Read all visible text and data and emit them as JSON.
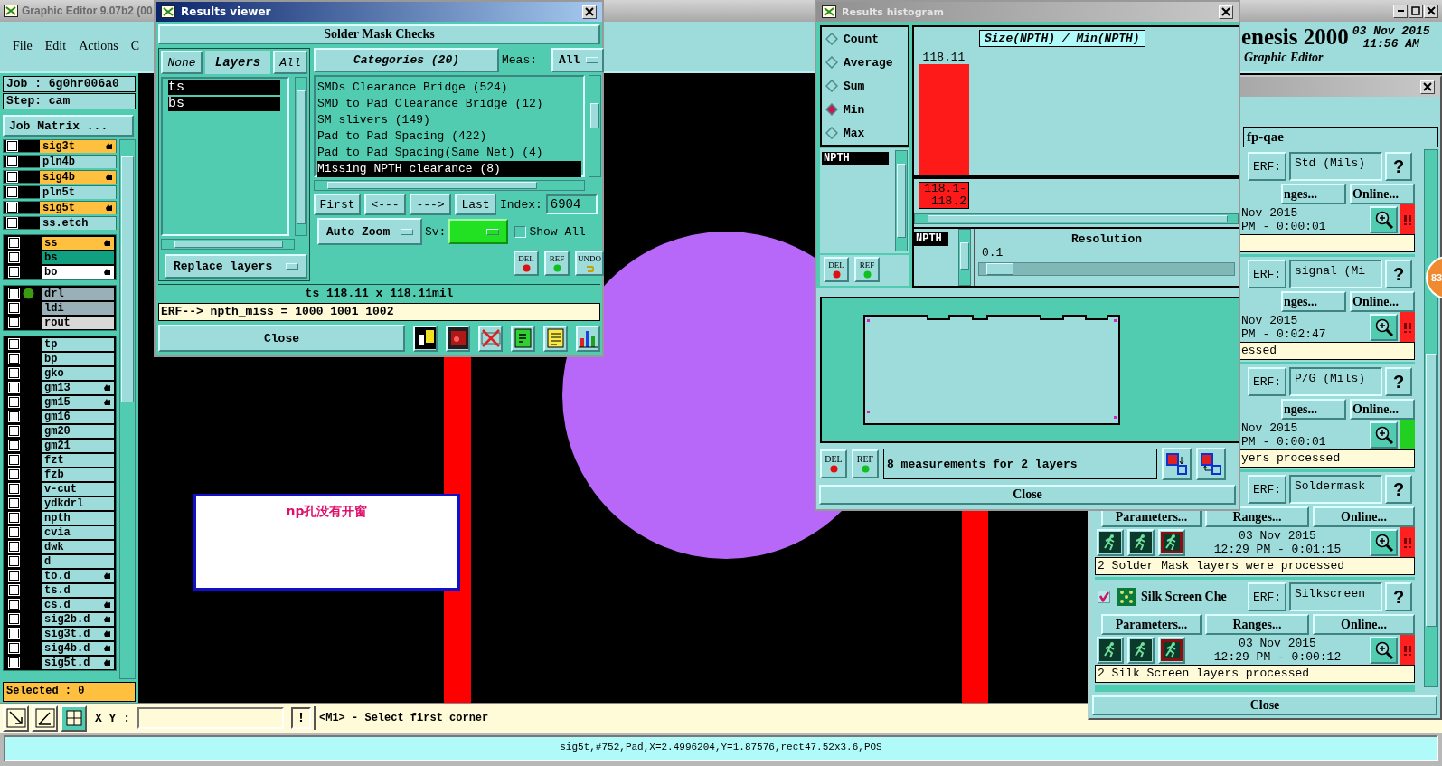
{
  "main_window": {
    "title": "Graphic Editor 9.07b2 (00",
    "menu": [
      "File",
      "Edit",
      "Actions",
      "C"
    ],
    "product": "enesis 2000",
    "date": "03 Nov 2015",
    "time": "11:56 AM",
    "subtitle": "Graphic Editor"
  },
  "job_panel": {
    "job": "Job : 6g0hr006a0",
    "step": "Step: cam",
    "matrix_button": "Job Matrix ...",
    "selected": "Selected : 0",
    "layer_groups": [
      {
        "spaced": true,
        "layers": [
          {
            "name": "sig3t",
            "color": "#ffc040",
            "checked": false,
            "marked": true,
            "active": false
          },
          {
            "name": "pln4b",
            "color": "#9edcdc",
            "checked": false,
            "marked": false,
            "active": false
          },
          {
            "name": "sig4b",
            "color": "#ffc040",
            "checked": false,
            "marked": true,
            "active": false
          },
          {
            "name": "pln5t",
            "color": "#9edcdc",
            "checked": false,
            "marked": false,
            "active": false
          },
          {
            "name": "sig5t",
            "color": "#ffc040",
            "checked": false,
            "marked": true,
            "active": false
          },
          {
            "name": "ss.etch",
            "color": "#9edcdc",
            "checked": false,
            "marked": false,
            "active": false
          }
        ]
      },
      {
        "spaced": false,
        "layers": [
          {
            "name": "ss",
            "color": "#ffc040",
            "checked": false,
            "marked": true,
            "active": false
          },
          {
            "name": "bs",
            "color": "#10a080",
            "checked": false,
            "marked": false,
            "active": false
          },
          {
            "name": "bo",
            "color": "#ffffff",
            "checked": false,
            "marked": true,
            "active": false
          }
        ]
      },
      {
        "spaced": false,
        "layers": [
          {
            "name": "drl",
            "color": "#9ab0b8",
            "checked": false,
            "marked": false,
            "active": true
          },
          {
            "name": "ldi",
            "color": "#9ab0b8",
            "checked": false,
            "marked": false,
            "active": false
          },
          {
            "name": "rout",
            "color": "#d8d8d8",
            "checked": false,
            "marked": false,
            "active": false
          }
        ]
      },
      {
        "spaced": false,
        "layers": [
          {
            "name": "tp",
            "color": "#9edcdc",
            "checked": false,
            "marked": false,
            "active": false
          },
          {
            "name": "bp",
            "color": "#9edcdc",
            "checked": false,
            "marked": false,
            "active": false
          },
          {
            "name": "gko",
            "color": "#9edcdc",
            "checked": false,
            "marked": false,
            "active": false
          },
          {
            "name": "gm13",
            "color": "#9edcdc",
            "checked": false,
            "marked": true,
            "active": false
          },
          {
            "name": "gm15",
            "color": "#9edcdc",
            "checked": false,
            "marked": true,
            "active": false
          },
          {
            "name": "gm16",
            "color": "#9edcdc",
            "checked": false,
            "marked": false,
            "active": false
          },
          {
            "name": "gm20",
            "color": "#9edcdc",
            "checked": false,
            "marked": false,
            "active": false
          },
          {
            "name": "gm21",
            "color": "#9edcdc",
            "checked": false,
            "marked": false,
            "active": false
          },
          {
            "name": "fzt",
            "color": "#9edcdc",
            "checked": false,
            "marked": false,
            "active": false
          },
          {
            "name": "fzb",
            "color": "#9edcdc",
            "checked": false,
            "marked": false,
            "active": false
          },
          {
            "name": "v-cut",
            "color": "#9edcdc",
            "checked": false,
            "marked": false,
            "active": false
          },
          {
            "name": "ydkdrl",
            "color": "#9edcdc",
            "checked": false,
            "marked": false,
            "active": false
          },
          {
            "name": "npth",
            "color": "#9edcdc",
            "checked": false,
            "marked": false,
            "active": false
          },
          {
            "name": "cvia",
            "color": "#9edcdc",
            "checked": false,
            "marked": false,
            "active": false
          },
          {
            "name": "dwk",
            "color": "#9edcdc",
            "checked": false,
            "marked": false,
            "active": false
          },
          {
            "name": "d",
            "color": "#9edcdc",
            "checked": false,
            "marked": false,
            "active": false
          },
          {
            "name": "to.d",
            "color": "#9edcdc",
            "checked": false,
            "marked": true,
            "active": false
          },
          {
            "name": "ts.d",
            "color": "#9edcdc",
            "checked": false,
            "marked": false,
            "active": false
          },
          {
            "name": "cs.d",
            "color": "#9edcdc",
            "checked": false,
            "marked": true,
            "active": false
          },
          {
            "name": "sig2b.d",
            "color": "#9edcdc",
            "checked": false,
            "marked": true,
            "active": false
          },
          {
            "name": "sig3t.d",
            "color": "#9edcdc",
            "checked": false,
            "marked": true,
            "active": false
          },
          {
            "name": "sig4b.d",
            "color": "#9edcdc",
            "checked": false,
            "marked": true,
            "active": false
          },
          {
            "name": "sig5t.d",
            "color": "#9edcdc",
            "checked": false,
            "marked": true,
            "active": false
          }
        ]
      }
    ]
  },
  "canvas": {
    "annotation": "np孔没有开窗"
  },
  "command_bar": {
    "xy_label": "X Y :",
    "alert_button": "!",
    "prompt": "<M1> - Select first corner"
  },
  "status_bar": "sig5t,#752,Pad,X=2.4996204,Y=1.87576,rect47.52x3.6,POS",
  "results_viewer": {
    "title": "Results viewer",
    "header": "Solder Mask Checks",
    "layer_header": [
      {
        "label": "None",
        "kind": "button"
      },
      {
        "label": "Layers",
        "kind": "title"
      },
      {
        "label": "All",
        "kind": "button"
      }
    ],
    "layers": [
      {
        "name": "ts",
        "selected": true
      },
      {
        "name": "bs",
        "selected": true
      }
    ],
    "layer_mode": "Replace layers",
    "categories_button": "Categories (20)",
    "meas_label": "Meas:",
    "meas_value": "All",
    "categories": [
      {
        "label": "SMDs Clearance Bridge (524)",
        "selected": false
      },
      {
        "label": "SMD to Pad Clearance Bridge (12)",
        "selected": false
      },
      {
        "label": "SM slivers (149)",
        "selected": false
      },
      {
        "label": "Pad to Pad Spacing (422)",
        "selected": false
      },
      {
        "label": "Pad to Pad Spacing(Same Net) (4)",
        "selected": false
      },
      {
        "label": "Missing NPTH clearance (8)",
        "selected": true
      }
    ],
    "nav_buttons": [
      "First",
      "<---",
      "--->",
      "Last"
    ],
    "index_label": "Index:",
    "index_value": "6904",
    "zoom_mode": "Auto Zoom",
    "sv_label": "Sv:",
    "show_all": {
      "label": "Show All",
      "checked": false
    },
    "actions": [
      "DEL",
      "REF",
      "UNDO"
    ],
    "measurement": "ts 118.11 x 118.11mil",
    "erf": "ERF--> npth_miss = 1000 1001 1002",
    "close": "Close"
  },
  "histogram": {
    "title": "Results histogram",
    "modes": [
      {
        "label": "Count",
        "selected": false
      },
      {
        "label": "Average",
        "selected": false
      },
      {
        "label": "Sum",
        "selected": false
      },
      {
        "label": "Min",
        "selected": true
      },
      {
        "label": "Max",
        "selected": false
      }
    ],
    "layers": [
      {
        "name": "NPTH",
        "selected": true
      }
    ],
    "actions": [
      "DEL",
      "REF"
    ],
    "chart": {
      "title": "Size(NPTH) / Min(NPTH)",
      "bins": [
        {
          "value_label": "118.11",
          "range_label": "118.1-118.2"
        }
      ]
    },
    "lower_layers": [
      {
        "name": "NPTH",
        "selected": true
      }
    ],
    "resolution_label": "Resolution",
    "resolution_value": "0.1",
    "resolution": {
      "level": 0.03
    },
    "bottom_actions": [
      "DEL",
      "REF"
    ],
    "summary": "8 measurements for 2 layers",
    "close": "Close"
  },
  "checklist": {
    "field": "fp-qae",
    "close": "Close",
    "checks": [
      {
        "erf_label": "ERF:",
        "erf_value": "Std (Mils)",
        "help": "?",
        "buttons": [
          "nges...",
          "Online..."
        ],
        "date": "Nov 2015",
        "time": "PM - 0:00:01",
        "passed": false
      },
      {
        "erf_label": "ERF:",
        "erf_value": "signal (Mi",
        "help": "?",
        "buttons": [
          "nges...",
          "Online..."
        ],
        "date": "Nov 2015",
        "time": "PM - 0:02:47",
        "passed": false,
        "message": "essed"
      },
      {
        "erf_label": "ERF:",
        "erf_value": "P/G (Mils)",
        "help": "?",
        "buttons": [
          "nges...",
          "Online..."
        ],
        "date": "Nov 2015",
        "time": "PM - 0:00:01",
        "passed": true,
        "message": "yers processed"
      },
      {
        "erf_label": "ERF:",
        "erf_value": "Soldermask",
        "help": "?",
        "buttons": [
          "Parameters...",
          "Ranges...",
          "Online..."
        ],
        "tools": true,
        "date": "03 Nov 2015",
        "time": "12:29 PM - 0:01:15",
        "passed": false,
        "message": "2 Solder Mask layers were processed"
      },
      {
        "name": "Silk Screen Che",
        "checked": true,
        "erf_label": "ERF:",
        "erf_value": "Silkscreen",
        "help": "?",
        "buttons": [
          "Parameters...",
          "Ranges...",
          "Online..."
        ],
        "tools": true,
        "date": "03 Nov 2015",
        "time": "12:29 PM - 0:00:12",
        "passed": false,
        "message": "2 Silk Screen layers processed"
      }
    ]
  },
  "side_badge": "83"
}
